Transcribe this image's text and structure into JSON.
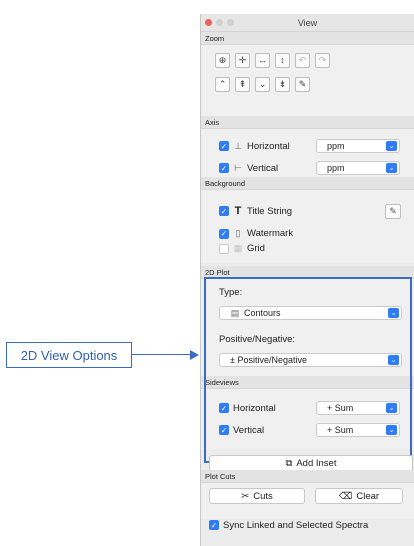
{
  "callout": {
    "label": "2D View Options"
  },
  "window": {
    "title": "View"
  },
  "zoom": {
    "header": "Zoom",
    "row1": [
      {
        "glyph": "⊕",
        "name": "zoom-in-icon",
        "enabled": true
      },
      {
        "glyph": "✛",
        "name": "zoom-full-icon",
        "enabled": true
      },
      {
        "glyph": "↔",
        "name": "zoom-horizontal-icon",
        "enabled": true
      },
      {
        "glyph": "↕",
        "name": "zoom-vertical-icon",
        "enabled": true
      },
      {
        "glyph": "↶",
        "name": "zoom-undo-icon",
        "enabled": false
      },
      {
        "glyph": "↷",
        "name": "zoom-redo-icon",
        "enabled": false
      }
    ],
    "row2": [
      {
        "glyph": "⌃",
        "name": "scale-up-icon",
        "enabled": true
      },
      {
        "glyph": "⇞",
        "name": "scale-up-fast-icon",
        "enabled": true
      },
      {
        "glyph": "⌄",
        "name": "scale-down-icon",
        "enabled": true
      },
      {
        "glyph": "⇟",
        "name": "scale-down-fast-icon",
        "enabled": true
      },
      {
        "glyph": "✎",
        "name": "auto-scale-icon",
        "enabled": true
      }
    ]
  },
  "axis": {
    "header": "Axis",
    "horizontal": {
      "label": "Horizontal",
      "checked": true,
      "unit": "ppm"
    },
    "vertical": {
      "label": "Vertical",
      "checked": true,
      "unit": "ppm"
    }
  },
  "background": {
    "header": "Background",
    "title_string": {
      "label": "Title String",
      "checked": true
    },
    "watermark": {
      "label": "Watermark",
      "checked": true
    },
    "grid": {
      "label": "Grid",
      "checked": false
    }
  },
  "plot2d": {
    "header": "2D Plot",
    "type_label": "Type:",
    "type_value": "Contours",
    "posneg_label": "Positive/Negative:",
    "posneg_value": "± Positive/Negative"
  },
  "sideviews": {
    "header": "Sideviews",
    "horizontal": {
      "label": "Horizontal",
      "checked": true,
      "mode": "+ Sum"
    },
    "vertical": {
      "label": "Vertical",
      "checked": true,
      "mode": "+ Sum"
    }
  },
  "add_inset": {
    "label": "Add Inset"
  },
  "plot_cuts": {
    "header": "Plot Cuts",
    "cuts_label": "Cuts",
    "clear_label": "Clear"
  },
  "sync": {
    "label": "Sync Linked and Selected Spectra",
    "checked": true
  },
  "colors": {
    "accent": "#2f7cf6",
    "callout": "#3a6cc6"
  }
}
